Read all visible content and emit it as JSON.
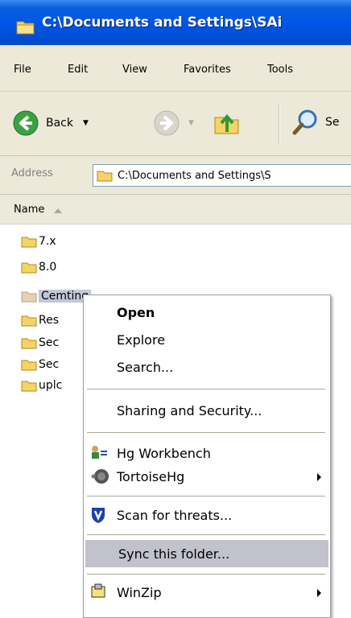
{
  "window": {
    "title": "C:\\Documents and Settings\\SAi"
  },
  "menu": [
    "File",
    "Edit",
    "View",
    "Favorites",
    "Tools"
  ],
  "toolbar": {
    "back_label": "Back",
    "search_label_partial": "Se"
  },
  "address": {
    "label": "Address",
    "value": "C:\\Documents and Settings\\S"
  },
  "columns": {
    "name": "Name"
  },
  "files": [
    {
      "name": "7.x"
    },
    {
      "name": "8.0"
    },
    {
      "name": "Cem",
      "tail": "ting",
      "selected": true
    },
    {
      "name": "Res"
    },
    {
      "name": "Sec"
    },
    {
      "name": "Sec"
    },
    {
      "name": "uplc"
    }
  ],
  "context_menu": [
    {
      "label": "Open",
      "bold": true
    },
    {
      "label": "Explore"
    },
    {
      "label": "Search..."
    },
    {
      "label": "Sharing and Security..."
    },
    {
      "label": "Hg Workbench",
      "icon": "hg-workbench-icon"
    },
    {
      "label": "TortoiseHg",
      "icon": "tortoisehg-icon",
      "submenu": true
    },
    {
      "label": "Scan for threats...",
      "icon": "shield-icon"
    },
    {
      "label": "Sync this folder...",
      "highlighted": true
    },
    {
      "label": "WinZip",
      "icon": "winzip-icon",
      "submenu": true
    }
  ],
  "colors": {
    "titlebar": "#0055e5",
    "chrome": "#ece9d8",
    "highlight": "#c2c2cc",
    "folder": "#f4d04f"
  }
}
